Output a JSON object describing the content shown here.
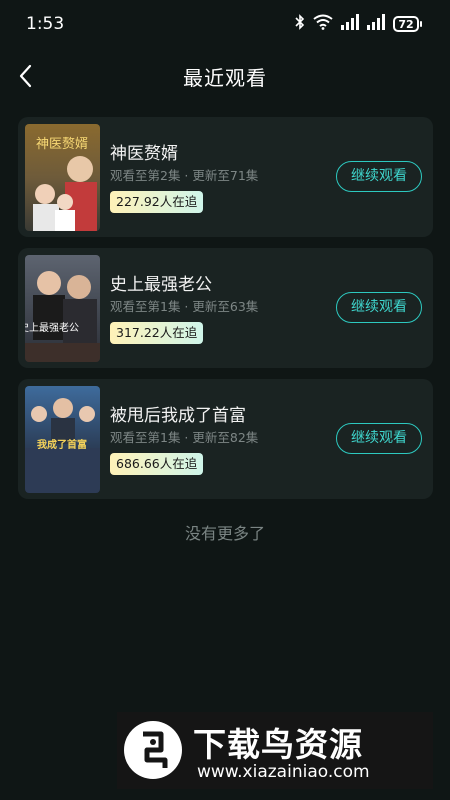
{
  "status_bar": {
    "time": "1:53",
    "battery": "72"
  },
  "header": {
    "title": "最近观看"
  },
  "list": [
    {
      "title": "神医赘婿",
      "progress": "观看至第2集 · 更新至71集",
      "followers": "227.92人在追",
      "action": "继续观看",
      "poster_text": "神医赘婿"
    },
    {
      "title": "史上最强老公",
      "progress": "观看至第1集 · 更新至63集",
      "followers": "317.22人在追",
      "action": "继续观看",
      "poster_text": "史上最强老公"
    },
    {
      "title": "被甩后我成了首富",
      "progress": "观看至第1集 · 更新至82集",
      "followers": "686.66人在追",
      "action": "继续观看",
      "poster_text": "我成了首富"
    }
  ],
  "footer": {
    "no_more": "没有更多了"
  },
  "watermark": {
    "name": "下载鸟资源",
    "url": "www.xiazainiao.com"
  },
  "colors": {
    "background": "#0f1615",
    "card": "#1a2322",
    "accent": "#2dc9c0"
  }
}
